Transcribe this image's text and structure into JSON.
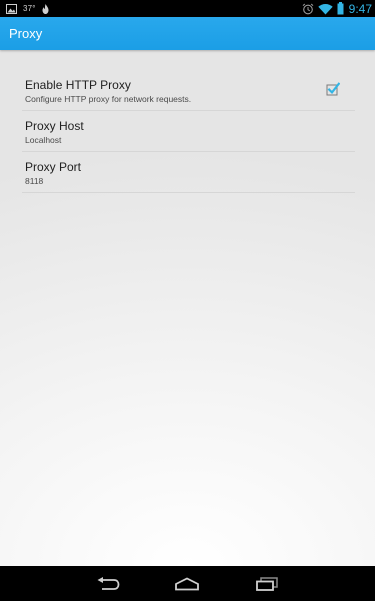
{
  "status_bar": {
    "time": "9:47",
    "temperature": "37°",
    "left_icons": [
      "gallery-icon",
      "flame-icon"
    ],
    "right_icons": [
      "alarm-icon",
      "wifi-icon",
      "battery-icon"
    ]
  },
  "action_bar": {
    "title": "Proxy",
    "color": "#1ba1e2"
  },
  "preferences": [
    {
      "title": "Enable HTTP Proxy",
      "summary": "Configure HTTP proxy for network requests.",
      "checked": true
    },
    {
      "title": "Proxy Host",
      "summary": "Localhost"
    },
    {
      "title": "Proxy Port",
      "summary": "8118"
    }
  ],
  "nav_bar": {
    "buttons": [
      "back-icon",
      "home-icon",
      "recent-apps-icon"
    ]
  },
  "colors": {
    "accent": "#33b5e5",
    "checkbox": "#33b5e5"
  }
}
